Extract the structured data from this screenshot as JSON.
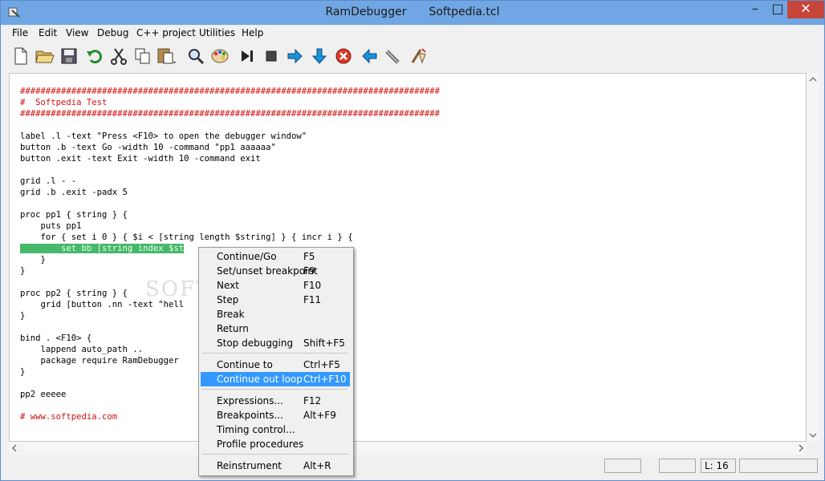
{
  "window": {
    "title_app": "RamDebugger",
    "title_file": "Softpedia.tcl"
  },
  "menubar": [
    "File",
    "Edit",
    "View",
    "Debug",
    "C++ project",
    "Utilities",
    "Help"
  ],
  "toolbar": {
    "icons": [
      "new-file-icon",
      "open-folder-icon",
      "save-icon",
      "undo-icon",
      "cut-icon",
      "copy-icon",
      "paste-icon",
      "find-icon",
      "palette-icon",
      "run-icon",
      "stop-icon",
      "step-icon",
      "step-into-icon",
      "cancel-icon",
      "back-icon",
      "tool-icon",
      "clean-icon"
    ]
  },
  "code": {
    "lines": [
      "##################################################################################",
      "#  Softpedia Test",
      "##################################################################################",
      "",
      "label .l -text \"Press <F10> to open the debugger window\"",
      "button .b -text Go -width 10 -command \"pp1 aaaaaa\"",
      "button .exit -text Exit -width 10 -command exit",
      "",
      "grid .l - -",
      "grid .b .exit -padx 5",
      "",
      "proc pp1 { string } {",
      "    puts pp1",
      "    for { set i 0 } { $i < [string length $string] } { incr i } {",
      "        set bb [string index $st",
      "    }",
      "}",
      "",
      "proc pp2 { string } {",
      "    grid [button .nn -text \"hell",
      "}",
      "",
      "bind . <F10> {",
      "    lappend auto_path ..",
      "    package require RamDebugger",
      "}",
      "",
      "pp2 eeeee",
      "",
      "# www.softpedia.com"
    ]
  },
  "context_menu": {
    "items": [
      {
        "label": "Continue/Go",
        "key": "F5"
      },
      {
        "label": "Set/unset breakpoint",
        "key": "F9"
      },
      {
        "label": "Next",
        "key": "F10"
      },
      {
        "label": "Step",
        "key": "F11"
      },
      {
        "label": "Break",
        "key": ""
      },
      {
        "label": "Return",
        "key": ""
      },
      {
        "label": "Stop debugging",
        "key": "Shift+F5"
      },
      {
        "label": "Continue to",
        "key": "Ctrl+F5"
      },
      {
        "label": "Continue out loop",
        "key": "Ctrl+F10"
      },
      {
        "label": "Expressions...",
        "key": "F12"
      },
      {
        "label": "Breakpoints...",
        "key": "Alt+F9"
      },
      {
        "label": "Timing control...",
        "key": ""
      },
      {
        "label": "Profile procedures",
        "key": ""
      },
      {
        "label": "Reinstrument",
        "key": "Alt+R"
      }
    ],
    "active_index": 8
  },
  "statusbar": {
    "line": "L: 16"
  },
  "colors": {
    "titlebar": "#6fa6e3",
    "selection": "#3399ff",
    "code_highlight": "#45b86b",
    "comment": "#d21010",
    "keyword_proc": "#9c0fd0",
    "keyword_for": "#3ebd3e"
  }
}
